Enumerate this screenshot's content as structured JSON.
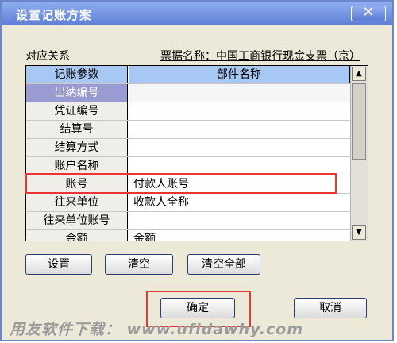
{
  "window": {
    "title": "设置记账方案",
    "close_glyph": "✕"
  },
  "left_label": "对应关系",
  "bill_name": "票据名称：中国工商银行现金支票（京）",
  "table": {
    "headers": [
      "记账参数",
      "部件名称"
    ],
    "rows": [
      [
        "出纳编号",
        ""
      ],
      [
        "凭证编号",
        ""
      ],
      [
        "结算号",
        ""
      ],
      [
        "结算方式",
        ""
      ],
      [
        "账户名称",
        ""
      ],
      [
        "账号",
        "付款人账号"
      ],
      [
        "往来单位",
        "收款人全称"
      ],
      [
        "往来单位账号",
        ""
      ],
      [
        "金额",
        "金额"
      ]
    ]
  },
  "scrollbar": {
    "up_icon": "▲",
    "down_icon": "▼"
  },
  "buttons": {
    "set": "设置",
    "clear": "清空",
    "clear_all": "清空全部",
    "ok": "确定",
    "cancel": "取消"
  },
  "watermark": "用友软件下载： www.ufidawhy.com"
}
